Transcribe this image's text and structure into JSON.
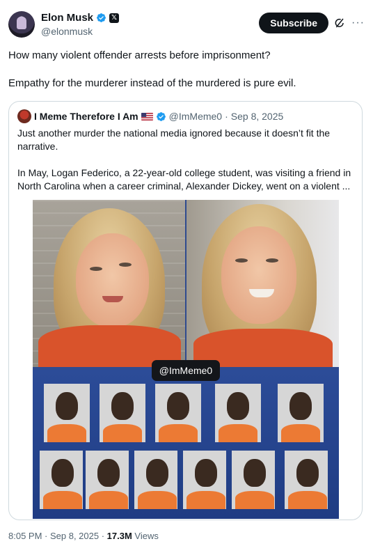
{
  "author": {
    "name": "Elon Musk",
    "handle": "@elonmusk",
    "x_badge": "𝕏",
    "avatar_icon": "profile-avatar",
    "verified_color": "#1d9bf0"
  },
  "actions": {
    "subscribe_label": "Subscribe",
    "grok_icon": "grok-icon",
    "more_icon": "more-icon",
    "more_glyph": "···"
  },
  "tweet": {
    "paragraphs": [
      "How many violent offender arrests before imprisonment?",
      "Empathy for the murderer instead of the murdered is pure evil."
    ]
  },
  "quote": {
    "name": "I Meme Therefore I Am",
    "flag_icon": "us-flag-icon",
    "handle": "@ImMeme0",
    "separator": "·",
    "date": "Sep 8, 2025",
    "paragraphs": [
      "Just another murder the national media ignored because it doesn’t fit the narrative.",
      "In May, Logan Federico, a 22-year-old college student, was visiting a friend in North Carolina when a career criminal, Alexander Dickey, went on a violent ..."
    ],
    "media": {
      "watermark": "@ImMeme0",
      "mugshot_rows": [
        5,
        6
      ]
    }
  },
  "meta": {
    "time": "8:05 PM",
    "sep1": " · ",
    "date": "Sep 8, 2025",
    "sep2": " · ",
    "views_count": "17.3M",
    "views_label": " Views"
  }
}
